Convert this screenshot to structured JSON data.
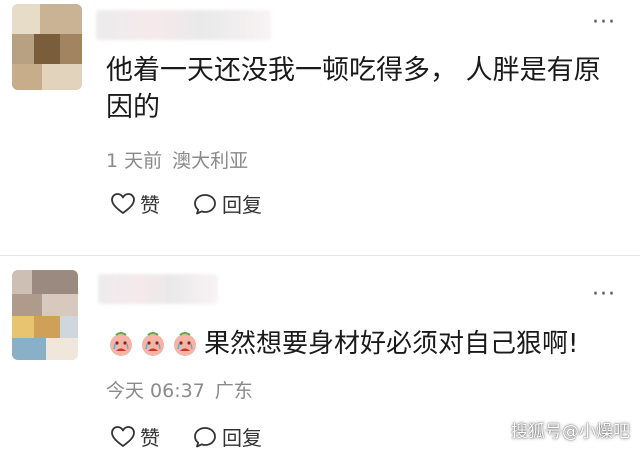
{
  "comments": [
    {
      "more_icon": "more-dots-icon",
      "text": "他着一天还没我一顿吃得多，  人胖是有原因的",
      "time": "1 天前",
      "location": "澳大利亚",
      "like_label": "赞",
      "reply_label": "回复"
    },
    {
      "more_icon": "more-dots-icon",
      "emoji_icons": [
        "crying-emoji-icon",
        "crying-emoji-icon",
        "crying-emoji-icon"
      ],
      "text": "果然想要身材好必须对自己狠啊!",
      "time": "今天 06:37",
      "location": "广东",
      "like_label": "赞",
      "reply_label": "回复"
    }
  ],
  "watermark": {
    "text": "搜狐号@小燥吧"
  },
  "colors": {
    "text": "#1a1a1a",
    "meta": "#8a8a8a",
    "divider": "#e6e6e6"
  }
}
